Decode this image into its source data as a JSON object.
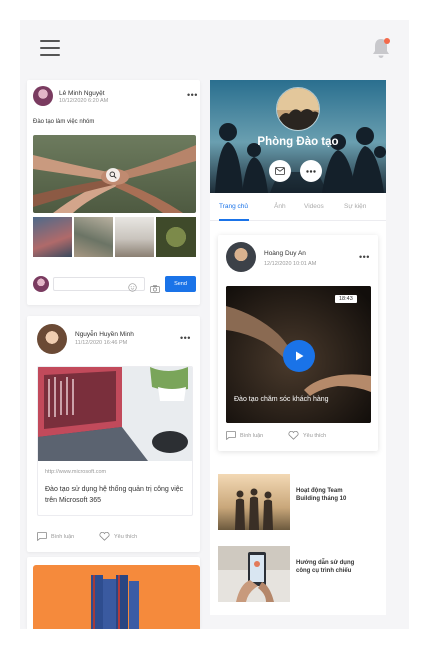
{
  "header": {
    "menu_icon": "hamburger-icon",
    "notification_icon": "bell-icon",
    "notification_dot_color": "#f36a4b"
  },
  "post1": {
    "author": "Lê Minh Nguyệt",
    "time": "10/12/2020 6:20 AM",
    "text": "Đào tạo làm việc nhóm",
    "comment_placeholder": "",
    "send_label": "Send"
  },
  "post2": {
    "author": "Nguyễn Huyền Minh",
    "time": "11/12/2020 16:46 PM",
    "link_url": "http://www.microsoft.com",
    "link_title": "Đào tạo sử dụng hệ thống quản trị công việc trên Microsoft 365",
    "comment_label": "Bình luận",
    "like_label": "Yêu thích"
  },
  "group": {
    "name": "Phòng Đào tạo",
    "tabs": [
      {
        "label": "Trang chủ",
        "active": true
      },
      {
        "label": "Ảnh",
        "active": false
      },
      {
        "label": "Videos",
        "active": false
      },
      {
        "label": "Sự kiện",
        "active": false
      }
    ]
  },
  "video_post": {
    "author": "Hoàng Duy An",
    "time": "12/12/2020 10:01 AM",
    "duration": "18:43",
    "caption": "Đào tạo chăm sóc khách hàng",
    "comment_label": "Bình luận",
    "like_label": "Yêu thích"
  },
  "news": [
    {
      "title": "Hoạt động Team Building tháng 10"
    },
    {
      "title": "Hướng dẫn sử dụng công cụ trình chiếu"
    }
  ],
  "colors": {
    "accent": "#1a73e8",
    "background": "#f5f5f7"
  }
}
